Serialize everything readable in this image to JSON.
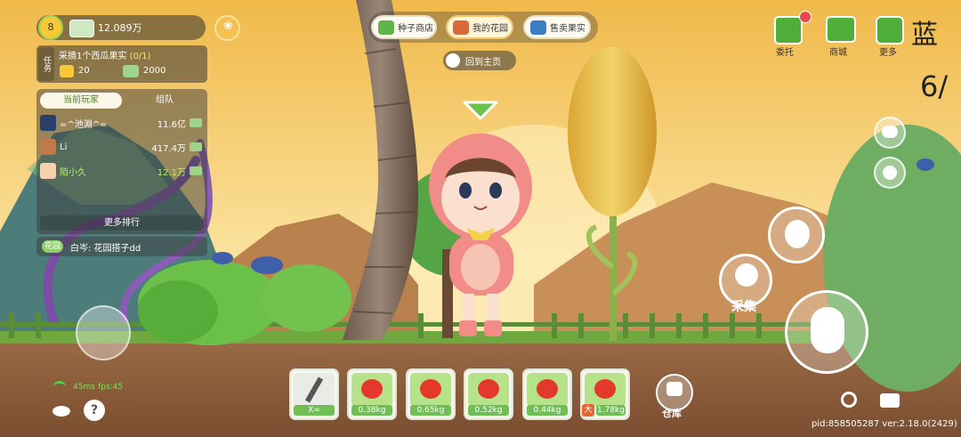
{
  "hud": {
    "level": "8",
    "coins": "12.089万"
  },
  "task": {
    "tag": "任务",
    "title": "采摘1个西瓜果实",
    "progress": "(0/1)",
    "reward_stars": "20",
    "reward_cash": "2000"
  },
  "leaderboard": {
    "tabs": [
      "当前玩家",
      "组队"
    ],
    "players": [
      {
        "name": "=^池淵^=",
        "value": "11.6亿"
      },
      {
        "name": "Li",
        "value": "417.4万"
      },
      {
        "name": "陌小久",
        "value": "12.1万"
      }
    ],
    "more": "更多排行"
  },
  "chat": {
    "channel": "花园",
    "message": "白岑: 花园搭子dd"
  },
  "top_nav": {
    "seed_shop": "种子商店",
    "my_garden": "我的花园",
    "sell_fruit": "售卖果实",
    "back_home": "回到主页"
  },
  "right_menu": {
    "entrust": "委托",
    "shop": "商城",
    "more": "更多",
    "corner_title": "蓝",
    "corner_count": "6/"
  },
  "actions": {
    "harvest": "采集",
    "warehouse": "仓库"
  },
  "hotbar": [
    {
      "item": "shovel",
      "label": "X∞"
    },
    {
      "item": "tomato",
      "label": "0.38kg"
    },
    {
      "item": "tomato",
      "label": "0.65kg"
    },
    {
      "item": "tomato",
      "label": "0.52kg"
    },
    {
      "item": "tomato",
      "label": "0.44kg"
    },
    {
      "item": "tomato",
      "label": "1.78kg",
      "badge": "大"
    }
  ],
  "network": {
    "ping": "45ms",
    "fps": "fps:45"
  },
  "build_info": "pid:858505287 ver:2.18.0(2429)",
  "colors": {
    "sky_top": "#f4c45a",
    "sky_bottom": "#fbe6a6",
    "ground": "#8a5a3a",
    "accent_green": "#6fbf55",
    "panel": "#3b3b3b"
  }
}
